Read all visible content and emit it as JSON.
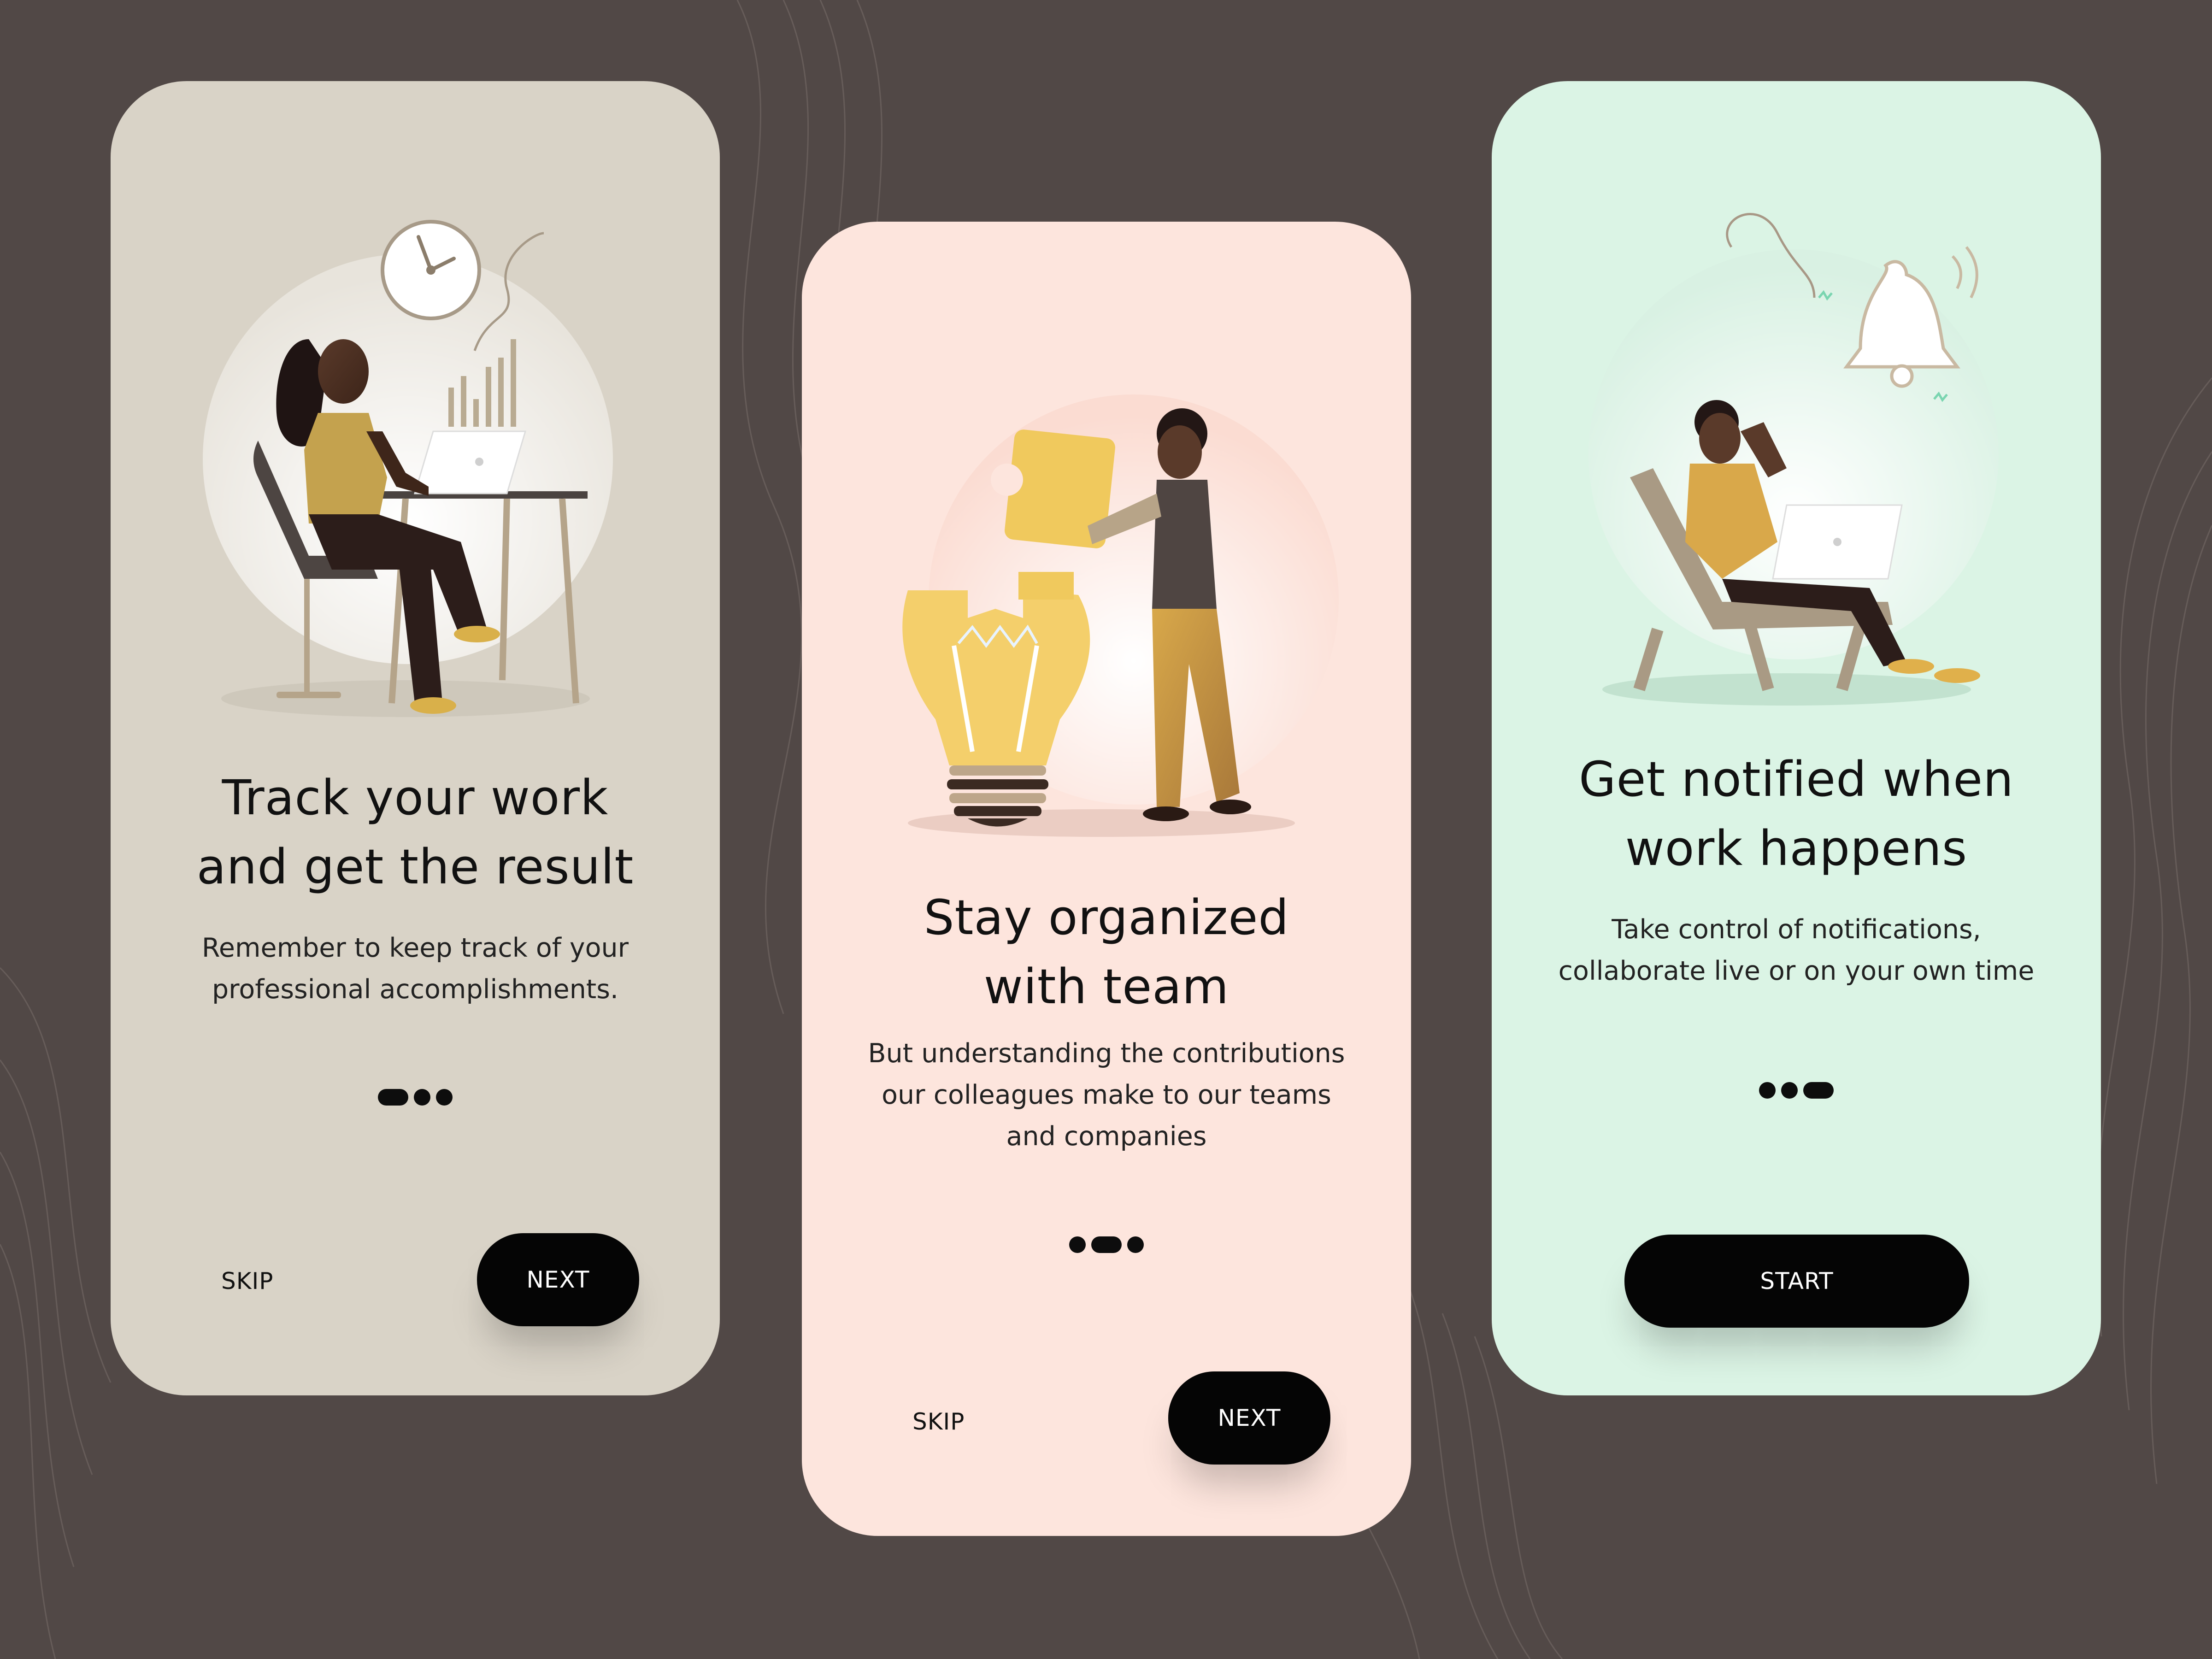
{
  "background_color": "#514846",
  "screens": [
    {
      "bg_color": "#d9d3c7",
      "title_line1": "Track your work",
      "title_line2": "and get the result",
      "desc_line1": "Remember to keep track of your",
      "desc_line2": "professional accomplishments.",
      "active_step": 1,
      "skip_label": "SKIP",
      "next_label": "NEXT",
      "illustration": "woman-working-at-desk-with-clock-and-chart"
    },
    {
      "bg_color": "#fde5dd",
      "title_line1": "Stay organized",
      "title_line2": "with team",
      "desc_line1": "But understanding the contributions",
      "desc_line2": "our colleagues make to our teams",
      "desc_line3": "and companies",
      "active_step": 2,
      "skip_label": "SKIP",
      "next_label": "NEXT",
      "illustration": "man-placing-puzzle-piece-in-lightbulb"
    },
    {
      "bg_color": "#dbf4e5",
      "title_line1": "Get notified when",
      "title_line2": "work happens",
      "desc_line1": "Take control of notifications,",
      "desc_line2": "collaborate live or on your own time",
      "active_step": 3,
      "start_label": "START",
      "illustration": "man-on-phone-in-lounge-chair-with-bell"
    }
  ],
  "step_count": 3
}
